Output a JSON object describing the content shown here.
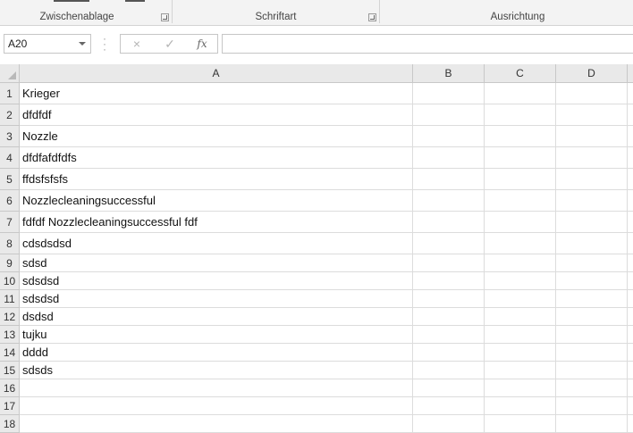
{
  "ribbon": {
    "groups": [
      {
        "label": "Zwischenablage"
      },
      {
        "label": "Schriftart"
      },
      {
        "label": "Ausrichtung"
      }
    ]
  },
  "formula_bar": {
    "name_box": "A20",
    "cancel_icon": "×",
    "enter_icon": "✓",
    "fx_icon": "fx",
    "formula": ""
  },
  "sheet": {
    "columns": [
      "A",
      "B",
      "C",
      "D"
    ],
    "rows": [
      {
        "num": "1",
        "a": "Krieger"
      },
      {
        "num": "2",
        "a": "dfdfdf"
      },
      {
        "num": "3",
        "a": "Nozzle"
      },
      {
        "num": "4",
        "a": "dfdfafdfdfs"
      },
      {
        "num": "5",
        "a": "ffdsfsfsfs"
      },
      {
        "num": "6",
        "a": "Nozzlecleaningsuccessful"
      },
      {
        "num": "7",
        "a": "fdfdf Nozzlecleaningsuccessful  fdf"
      },
      {
        "num": "8",
        "a": "cdsdsdsd"
      },
      {
        "num": "9",
        "a": "sdsd"
      },
      {
        "num": "10",
        "a": "sdsdsd"
      },
      {
        "num": "11",
        "a": "sdsdsd"
      },
      {
        "num": "12",
        "a": "dsdsd"
      },
      {
        "num": "13",
        "a": "tujku"
      },
      {
        "num": "14",
        "a": "dddd"
      },
      {
        "num": "15",
        "a": "sdsds"
      },
      {
        "num": "16",
        "a": ""
      },
      {
        "num": "17",
        "a": ""
      },
      {
        "num": "18",
        "a": ""
      }
    ]
  }
}
